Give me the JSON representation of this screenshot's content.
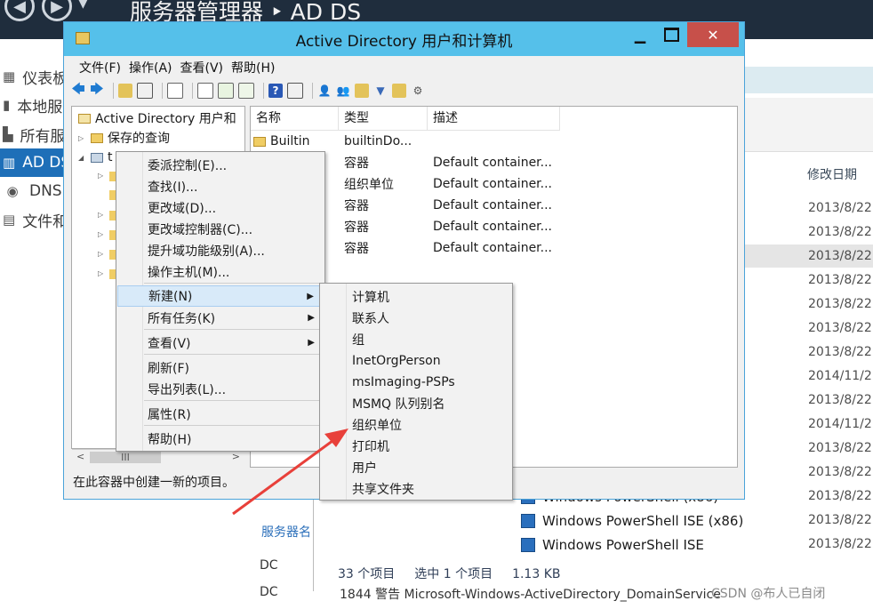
{
  "server_manager": {
    "title": "服务器管理器 ‣ AD DS",
    "nav": [
      {
        "label": "仪表板",
        "icon": "dashboard-icon"
      },
      {
        "label": "本地服务器",
        "icon": "server-icon"
      },
      {
        "label": "所有服务器",
        "icon": "servers-icon"
      },
      {
        "label": "AD DS",
        "icon": "ad-icon"
      },
      {
        "label": "DNS",
        "icon": "dns-icon"
      },
      {
        "label": "文件和存储服务",
        "icon": "file-storage-icon"
      }
    ],
    "section_header": "服务器名",
    "dc_rows": [
      "DC",
      "DC"
    ],
    "bottom_log": "1844  警告      Microsoft-Windows-ActiveDirectory_DomainService"
  },
  "explorer": {
    "column_header": "修改日期",
    "dates": [
      "2013/8/22",
      "2013/8/22",
      "2013/8/22",
      "2013/8/22",
      "2013/8/22",
      "2013/8/22",
      "2013/8/22",
      "2014/11/2",
      "2013/8/22",
      "2014/11/2",
      "2013/8/22",
      "2013/8/22",
      "2013/8/22",
      "2013/8/22",
      "2013/8/22"
    ],
    "items": [
      {
        "name": "Windows PowerShell (x86)"
      },
      {
        "name": "Windows PowerShell ISE (x86)"
      },
      {
        "name": "Windows PowerShell ISE"
      }
    ],
    "status": {
      "count": "33 个项目",
      "selected": "选中 1 个项目",
      "size": "1.13 KB"
    }
  },
  "aduc": {
    "title": "Active Directory 用户和计算机",
    "menu": [
      "文件(F)",
      "操作(A)",
      "查看(V)",
      "帮助(H)"
    ],
    "tree": {
      "root": "Active Directory 用户和",
      "saved_queries": "保存的查询",
      "domain": "t"
    },
    "columns": [
      "名称",
      "类型",
      "描述"
    ],
    "rows": [
      {
        "name": "Builtin",
        "type": "builtinDo...",
        "desc": ""
      },
      {
        "name": "",
        "type": "容器",
        "desc": "Default container..."
      },
      {
        "name": "",
        "type": "组织单位",
        "desc": "Default container..."
      },
      {
        "name": "",
        "type": "容器",
        "desc": "Default container..."
      },
      {
        "name": "",
        "type": "容器",
        "desc": "Default container..."
      },
      {
        "name": "",
        "type": "容器",
        "desc": "Default container..."
      }
    ],
    "status": "在此容器中创建一新的项目。",
    "scroll_thumb": "III"
  },
  "context_menu": {
    "items": [
      "委派控制(E)...",
      "查找(I)...",
      "更改域(D)...",
      "更改域控制器(C)...",
      "提升域功能级别(A)...",
      "操作主机(M)...",
      "新建(N)",
      "所有任务(K)",
      "查看(V)",
      "刷新(F)",
      "导出列表(L)...",
      "属性(R)",
      "帮助(H)"
    ]
  },
  "submenu": {
    "items": [
      "计算机",
      "联系人",
      "组",
      "InetOrgPerson",
      "msImaging-PSPs",
      "MSMQ 队列别名",
      "组织单位",
      "打印机",
      "用户",
      "共享文件夹"
    ]
  },
  "watermark": "CSDN @布人已自闭",
  "colors": {
    "titlebar": "#55c0ea",
    "accent": "#1e6fb8",
    "arrow": "#e8403a",
    "close": "#c7504a"
  }
}
